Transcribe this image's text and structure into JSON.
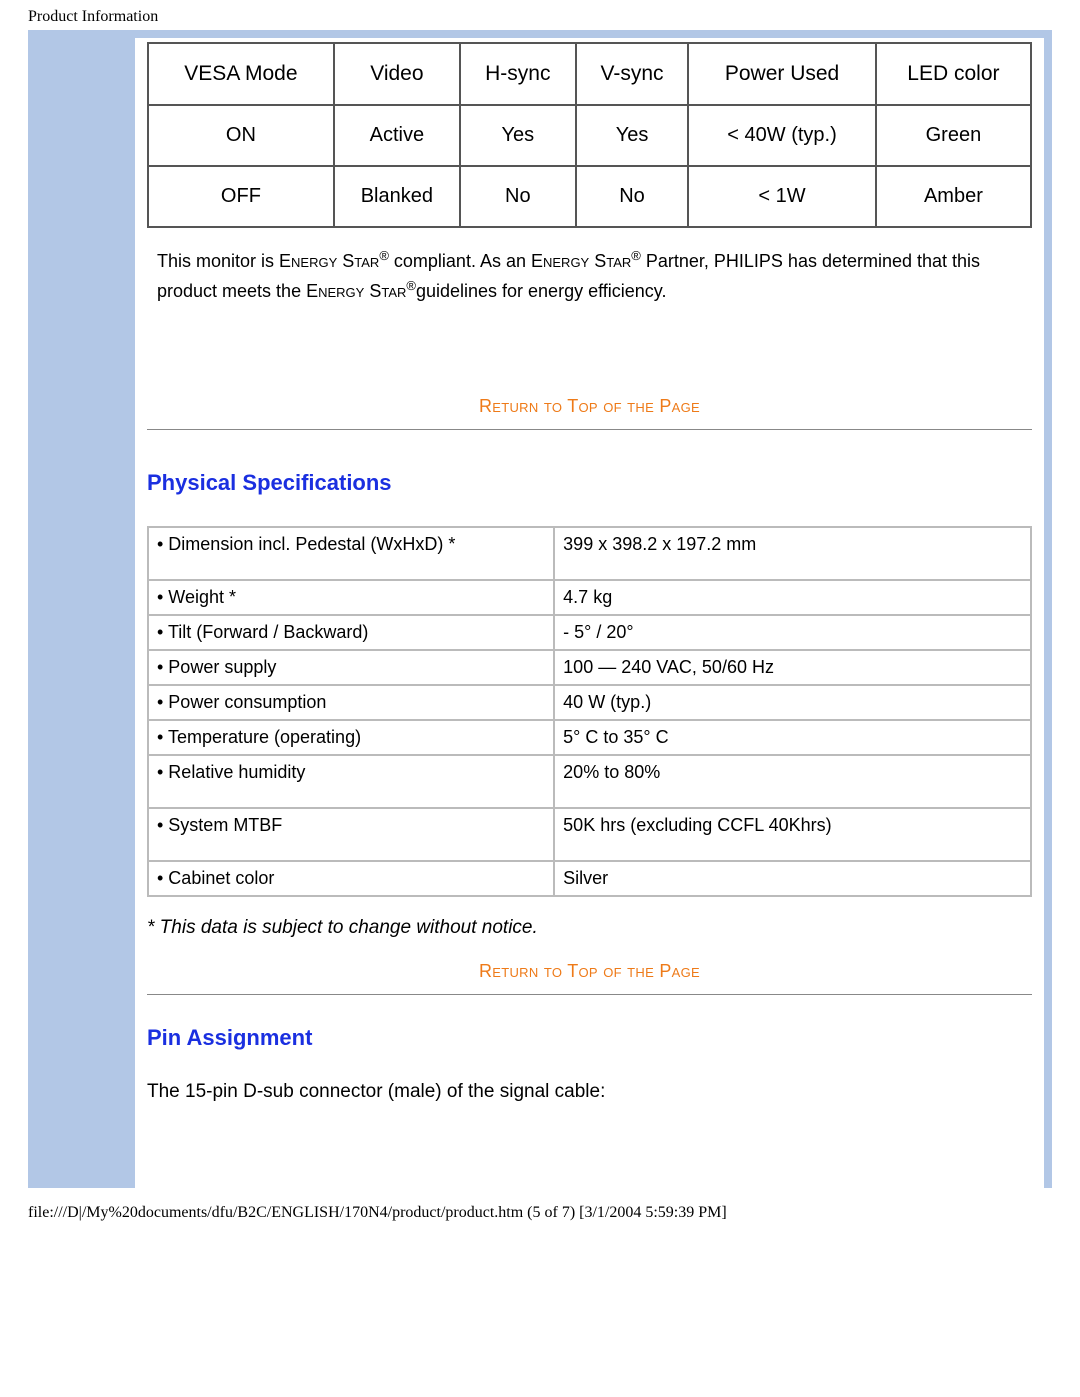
{
  "page_header": "Product Information",
  "power_table": {
    "headers": [
      "VESA Mode",
      "Video",
      "H-sync",
      "V-sync",
      "Power Used",
      "LED color"
    ],
    "rows": [
      [
        "ON",
        "Active",
        "Yes",
        "Yes",
        "< 40W (typ.)",
        "Green"
      ],
      [
        "OFF",
        "Blanked",
        "No",
        "No",
        "< 1W",
        "Amber"
      ]
    ]
  },
  "compliance": {
    "t1": "This monitor is ",
    "es1": "Energy Star",
    "t2": " compliant. As an ",
    "es2": "Energy Star",
    "t3": " Partner, PHILIPS has determined that this product meets the ",
    "es3": "Energy Star",
    "t4": "guidelines for energy efficiency."
  },
  "return_link": "Return to Top of the Page",
  "sections": {
    "physical_title": "Physical Specifications",
    "pin_title": "Pin Assignment",
    "pin_text": "The 15-pin D-sub connector (male) of the signal cable:"
  },
  "spec_rows": [
    {
      "label": "• Dimension incl. Pedestal (WxHxD) *",
      "value": "399 x 398.2 x 197.2 mm",
      "tall": true
    },
    {
      "label": "• Weight *",
      "value": "4.7 kg"
    },
    {
      "label": "• Tilt (Forward / Backward)",
      "value": "- 5° / 20°"
    },
    {
      "label": "• Power supply",
      "value": "100 — 240 VAC, 50/60 Hz"
    },
    {
      "label": "• Power consumption",
      "value": "40 W (typ.)"
    },
    {
      "label": "• Temperature (operating)",
      "value": "5° C to 35° C"
    },
    {
      "label": "• Relative humidity",
      "value": "20% to 80%",
      "tall": true
    },
    {
      "label": "• System MTBF",
      "value": "50K hrs (excluding CCFL 40Khrs)",
      "tall": true
    },
    {
      "label": "• Cabinet color",
      "value": "Silver"
    }
  ],
  "footnote": "* This data is subject to change without notice.",
  "footer": "file:///D|/My%20documents/dfu/B2C/ENGLISH/170N4/product/product.htm (5 of 7) [3/1/2004 5:59:39 PM]"
}
